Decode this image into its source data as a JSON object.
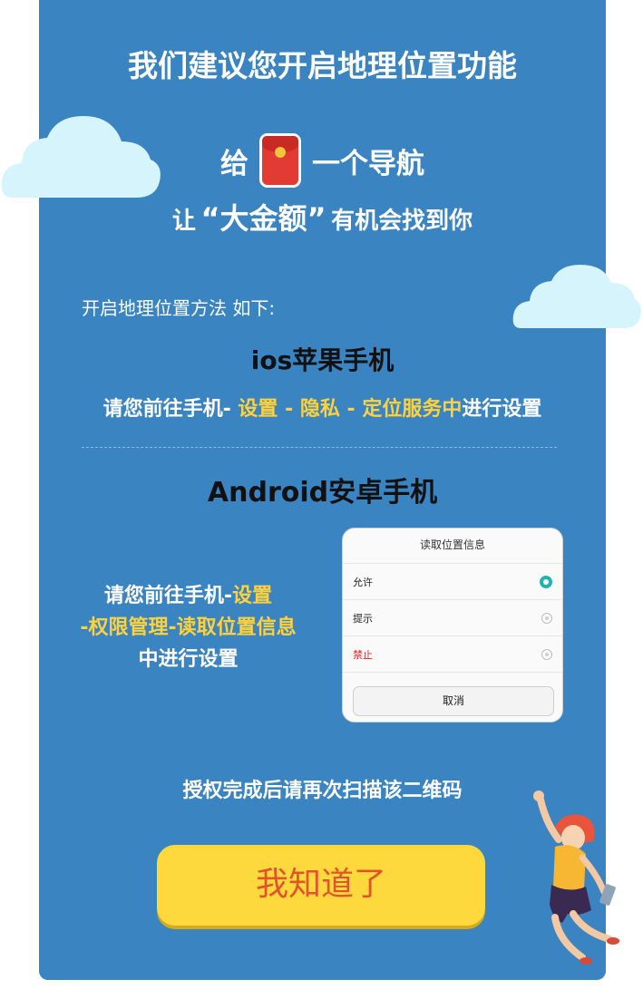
{
  "dialog_title": "我们建议您开启地理位置功能",
  "promo": {
    "give": "给",
    "navigate": "一个导航",
    "let": "让",
    "quote_open": "“",
    "amount": "大金额",
    "quote_close": "”",
    "chance": "有机会找到你"
  },
  "howto_label": "开启地理位置方法 如下:",
  "ios": {
    "title": "ios苹果手机",
    "prefix": "请您前往手机- ",
    "step1": "设置",
    "sep1": " - ",
    "step2": "隐私",
    "sep2": " - ",
    "step3": "定位服务中",
    "suffix": "进行设置"
  },
  "android": {
    "title": "Android安卓手机",
    "prefix": "请您前往手机-",
    "step1": "设置",
    "step2": "-权限管理-读取位置信息",
    "suffix": "中进行设置"
  },
  "permission_dialog": {
    "title": "读取位置信息",
    "options": [
      {
        "label": "允许",
        "selected": true,
        "color": "#222222"
      },
      {
        "label": "提示",
        "selected": false,
        "color": "#222222"
      },
      {
        "label": "禁止",
        "selected": false,
        "color": "#e2252b"
      }
    ],
    "cancel": "取消"
  },
  "rescan_text": "授权完成后请再次扫描该二维码",
  "confirm_button": "我知道了",
  "colors": {
    "background": "#3a84c1",
    "highlight": "#ffd23d",
    "button": "#fed93e",
    "button_text": "#e0542c"
  }
}
